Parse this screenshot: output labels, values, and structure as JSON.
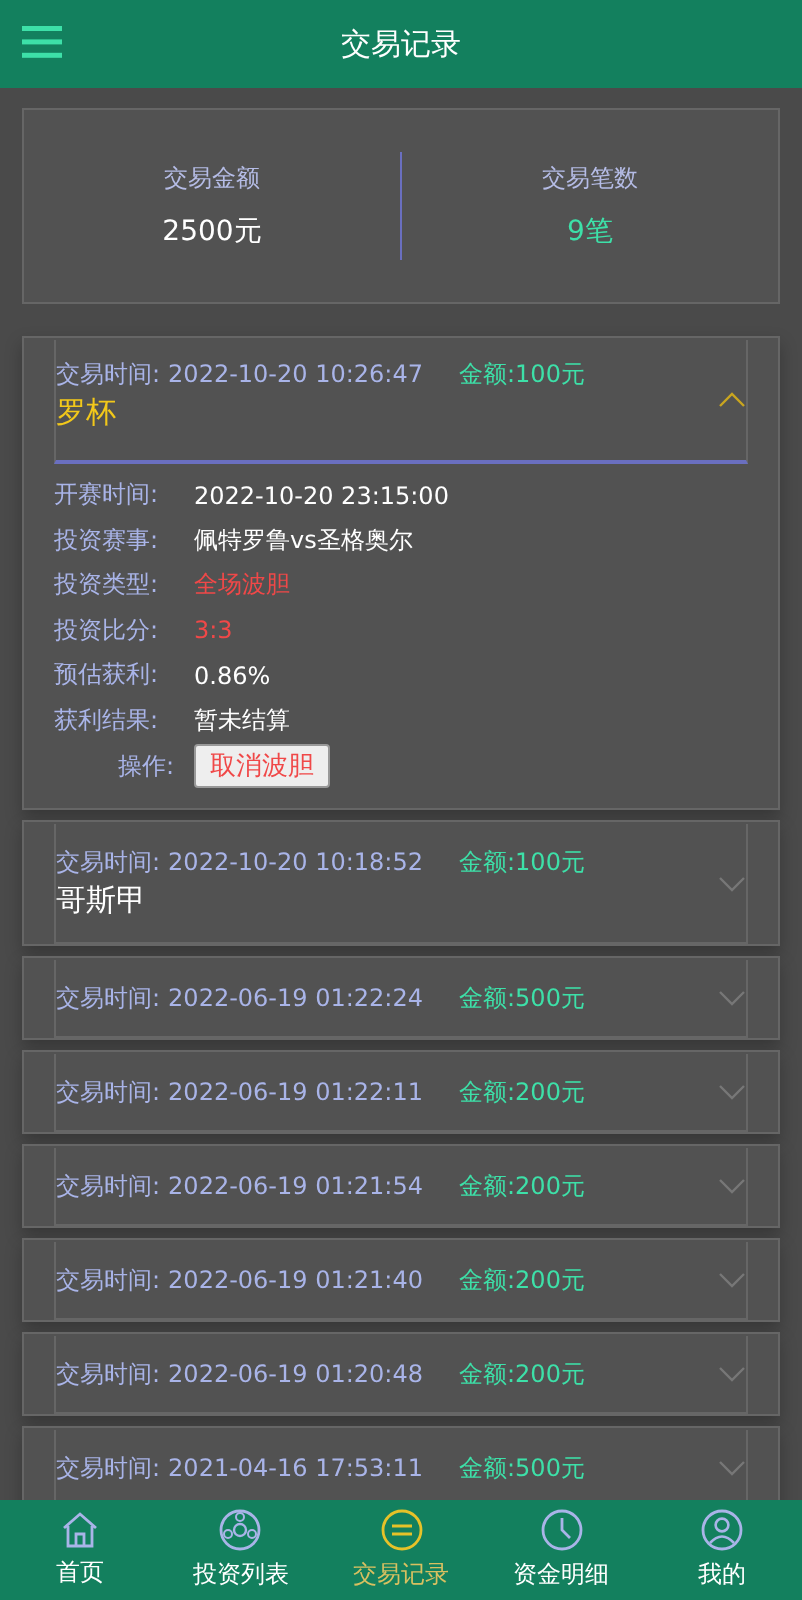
{
  "header": {
    "title": "交易记录"
  },
  "summary": [
    {
      "label": "交易金额",
      "value": "2500元",
      "accent": false
    },
    {
      "label": "交易笔数",
      "value": "9笔",
      "accent": true
    }
  ],
  "records": [
    {
      "time_label": "交易时间:",
      "time": "2022-10-20 10:26:47",
      "amount": "金额:100元",
      "name": "罗杯",
      "expanded": true,
      "details": [
        {
          "kind": "field",
          "label": "开赛时间:",
          "value": "2022-10-20 23:15:00",
          "highlight": false
        },
        {
          "kind": "field",
          "label": "投资赛事:",
          "value": "佩特罗鲁vs圣格奥尔",
          "highlight": false
        },
        {
          "kind": "field",
          "label": "投资类型:",
          "value": "全场波胆",
          "highlight": true
        },
        {
          "kind": "field",
          "label": "投资比分:",
          "value": "3:3",
          "highlight": true
        },
        {
          "kind": "field",
          "label": "预估获利:",
          "value": "0.86%",
          "highlight": false
        },
        {
          "kind": "field",
          "label": "获利结果:",
          "value": "暂未结算",
          "highlight": false
        },
        {
          "kind": "action",
          "label": "操作:",
          "value": "取消波胆",
          "highlight": true
        }
      ]
    },
    {
      "time_label": "交易时间:",
      "time": "2022-10-20 10:18:52",
      "amount": "金额:100元",
      "name": "哥斯甲",
      "expanded": false
    },
    {
      "time_label": "交易时间:",
      "time": "2022-06-19 01:22:24",
      "amount": "金额:500元",
      "expanded": false
    },
    {
      "time_label": "交易时间:",
      "time": "2022-06-19 01:22:11",
      "amount": "金额:200元",
      "expanded": false
    },
    {
      "time_label": "交易时间:",
      "time": "2022-06-19 01:21:54",
      "amount": "金额:200元",
      "expanded": false
    },
    {
      "time_label": "交易时间:",
      "time": "2022-06-19 01:21:40",
      "amount": "金额:200元",
      "expanded": false
    },
    {
      "time_label": "交易时间:",
      "time": "2022-06-19 01:20:48",
      "amount": "金额:200元",
      "expanded": false
    },
    {
      "time_label": "交易时间:",
      "time": "2021-04-16 17:53:11",
      "amount": "金额:500元",
      "expanded": false
    }
  ],
  "nav": [
    {
      "label": "首页",
      "selected": false
    },
    {
      "label": "投资列表",
      "selected": false
    },
    {
      "label": "交易记录",
      "selected": true
    },
    {
      "label": "资金明细",
      "selected": false
    },
    {
      "label": "我的",
      "selected": false
    }
  ]
}
